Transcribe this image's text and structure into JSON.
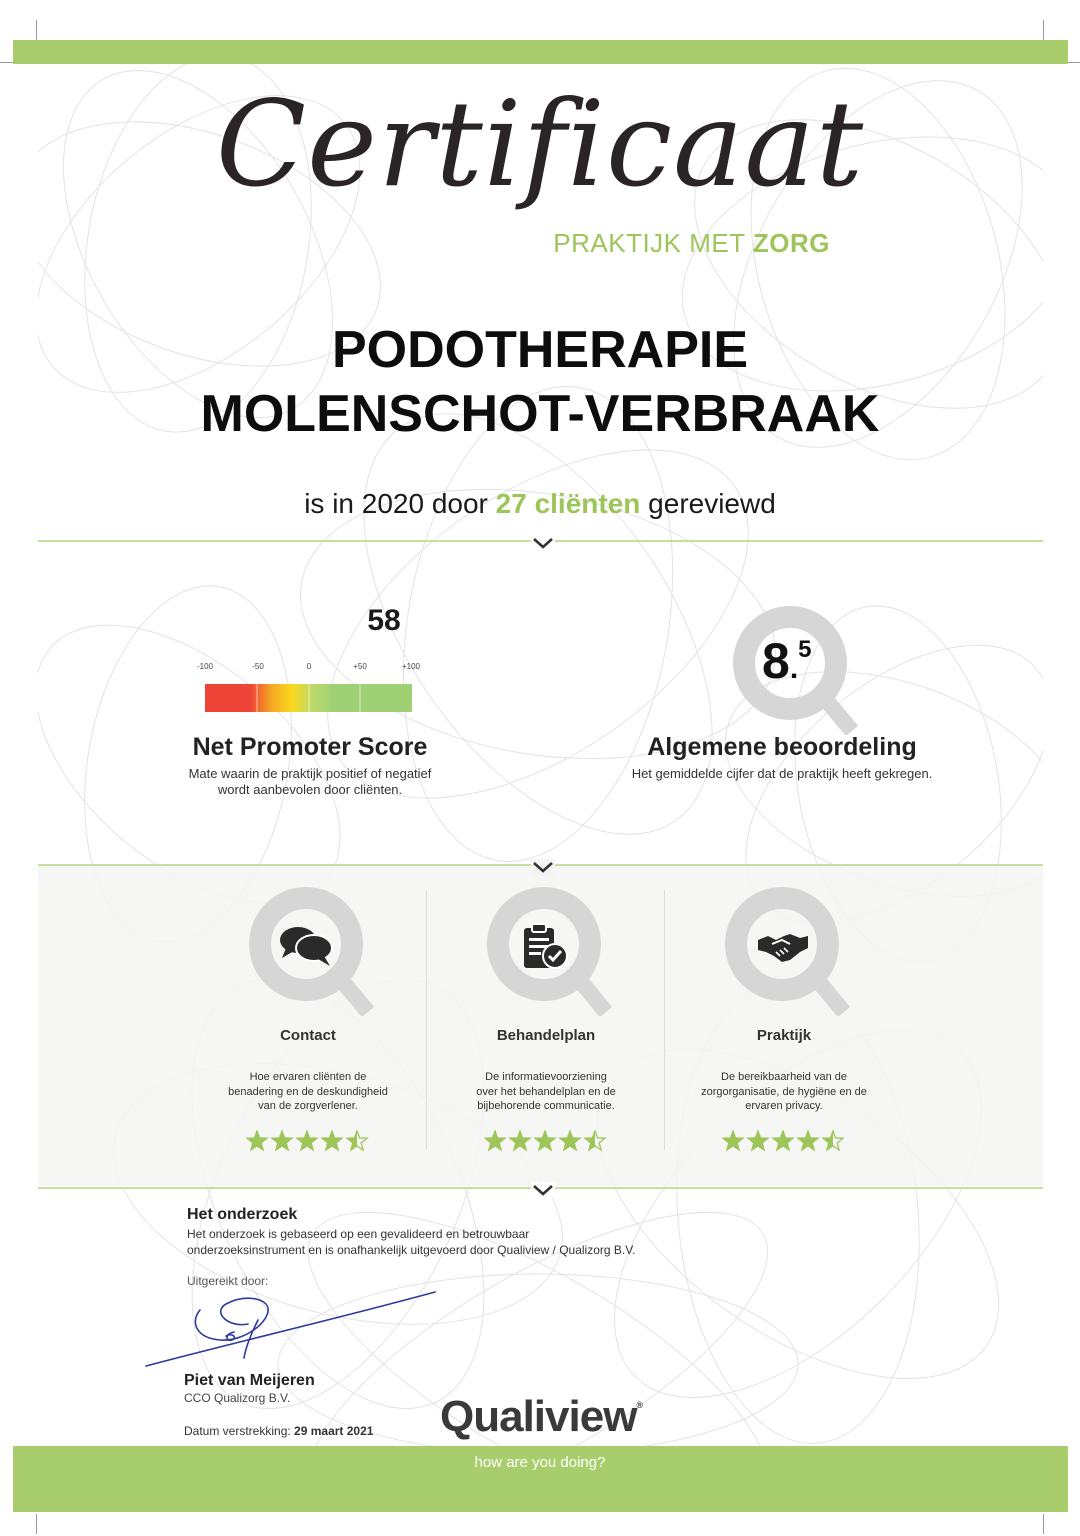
{
  "header": {
    "title": "Certificaat",
    "subtitle_prefix": "PRAKTIJK MET",
    "subtitle_emphasis": "ZORG"
  },
  "practice": {
    "line1": "PODOTHERAPIE",
    "line2": "MOLENSCHOT-VERBRAAK"
  },
  "reviewed": {
    "prefix": "is in 2020 door",
    "count": "27 cliënten",
    "suffix": "gereviewd"
  },
  "nps": {
    "value": "58",
    "scale_ticks": [
      "-100",
      "-50",
      "0",
      "+50",
      "+100"
    ],
    "title": "Net Promoter Score",
    "description_line1": "Mate waarin de praktijk positief of negatief",
    "description_line2": "wordt aanbevolen door cliënten."
  },
  "rating": {
    "integer": "8",
    "decimal": "5",
    "title": "Algemene beoordeling",
    "description": "Het gemiddelde cijfer dat de praktijk heeft gekregen."
  },
  "categories": [
    {
      "title": "Contact",
      "icon": "speech-bubbles-icon",
      "desc": [
        "Hoe ervaren cliënten de",
        "benadering en de deskundigheid",
        "van de zorgverlener."
      ],
      "stars": 4.5
    },
    {
      "title": "Behandelplan",
      "icon": "clipboard-check-icon",
      "desc": [
        "De informatievoorziening",
        "over het behandelplan en de",
        "bijbehorende communicatie."
      ],
      "stars": 4.5
    },
    {
      "title": "Praktijk",
      "icon": "handshake-icon",
      "desc": [
        "De bereikbaarheid van de",
        "zorgorganisatie, de hygiëne en de",
        "ervaren privacy."
      ],
      "stars": 4.5
    }
  ],
  "research": {
    "title": "Het onderzoek",
    "text_line1": "Het onderzoek is gebaseerd op een gevalideerd en betrouwbaar",
    "text_line2": "onderzoeksinstrument en is onafhankelijk uitgevoerd door Qualiview / Qualizorg B.V.",
    "issued_by": "Uitgereikt door:"
  },
  "signer": {
    "name": "Piet van Meijeren",
    "role": "CCO Qualizorg B.V."
  },
  "issue_date": {
    "label": "Datum verstrekking:",
    "value": "29 maart 2021"
  },
  "footer": {
    "logo": "Qualiview",
    "logo_mark": "®",
    "tagline": "how are you doing?"
  },
  "colors": {
    "brand_green": "#a7cd6c",
    "accent_green": "#9dc55a",
    "magnifier_grey": "#d6d6d6",
    "icon_dark": "#2a2a2a"
  }
}
